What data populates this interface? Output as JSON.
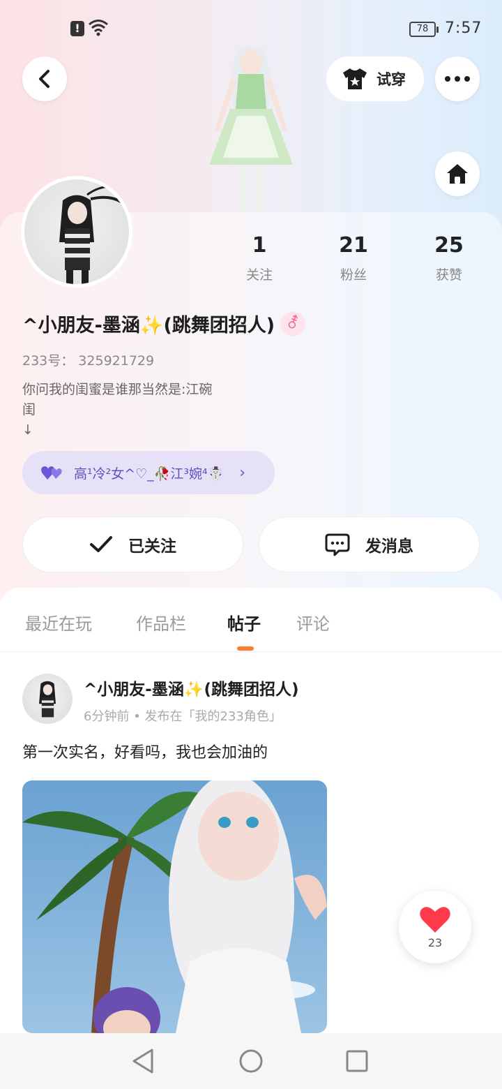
{
  "status_bar": {
    "time": "7:57",
    "battery": "78",
    "alert": "!"
  },
  "header": {
    "tryon_label": "试穿"
  },
  "profile": {
    "stats": [
      {
        "value": "1",
        "label": "关注"
      },
      {
        "value": "21",
        "label": "粉丝"
      },
      {
        "value": "25",
        "label": "获赞"
      }
    ],
    "nickname": "^小朋友-墨涵✨(跳舞团招人)",
    "gender_symbol": "⚦",
    "uid": "233号：  325921729",
    "bio": "你问我的闺蜜是谁那当然是:江碗\n闺\n↓",
    "tag": "高¹冷²女^♡_🥀江³婉⁴☃️",
    "follow_label": "已关注",
    "message_label": "发消息"
  },
  "tabs": [
    {
      "label": "最近在玩"
    },
    {
      "label": "作品栏"
    },
    {
      "label": "帖子"
    },
    {
      "label": "评论"
    }
  ],
  "post": {
    "author": "^小朋友-墨涵✨(跳舞团招人)",
    "meta": "6分钟前 • 发布在「我的233角色」",
    "text": "第一次实名，好看吗，我也会加油的",
    "likes": "23"
  },
  "colors": {
    "accent": "#ff7a2a",
    "tag_text": "#5e4fc4",
    "tag_bg": "#e6e1f7",
    "like": "#ff3b4a"
  }
}
